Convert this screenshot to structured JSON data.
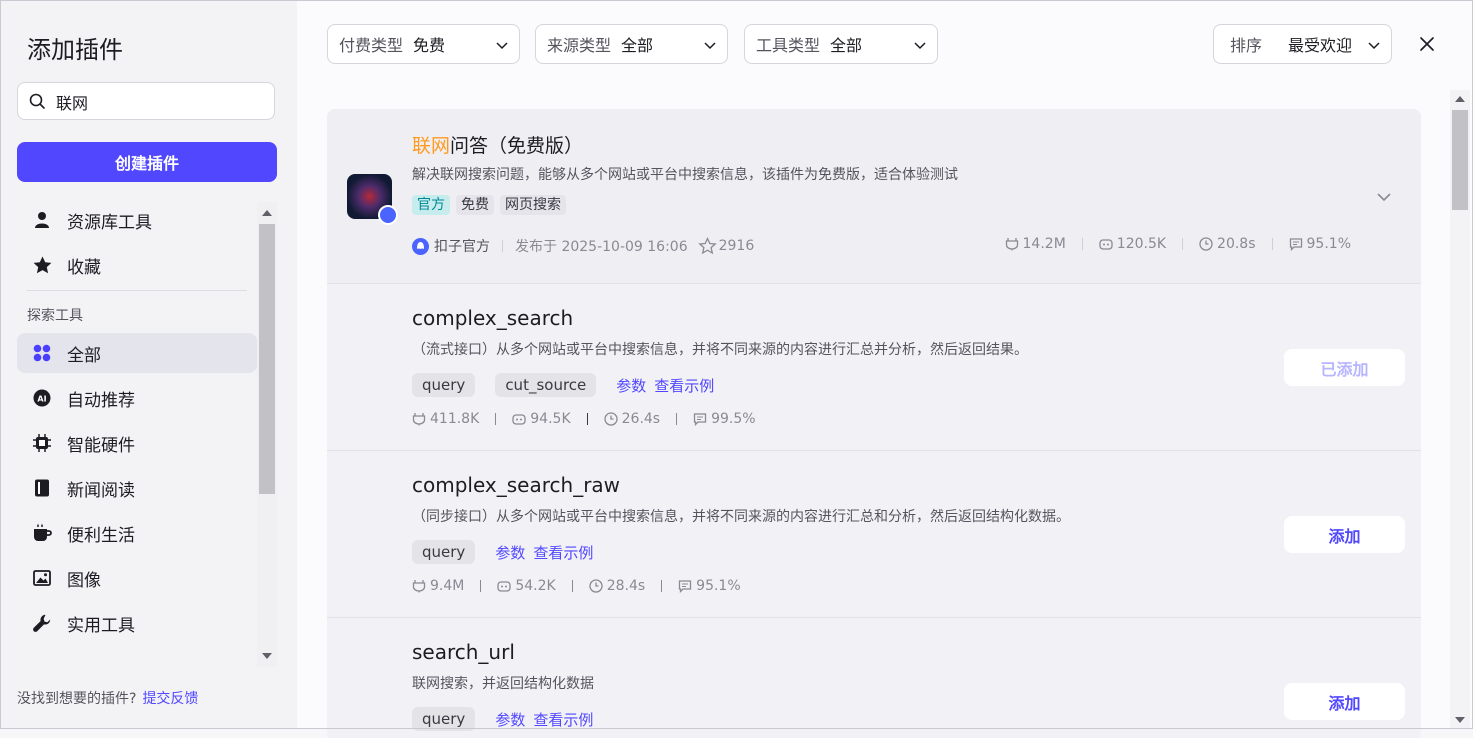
{
  "sidebar": {
    "title": "添加插件",
    "search_value": "联网",
    "create_label": "创建插件",
    "items_top": [
      {
        "label": "资源库工具",
        "icon": "person-icon"
      },
      {
        "label": "收藏",
        "icon": "star-icon"
      }
    ],
    "section_label": "探索工具",
    "items": [
      {
        "label": "全部",
        "icon": "grid-icon",
        "active": true
      },
      {
        "label": "自动推荐",
        "icon": "ai-icon"
      },
      {
        "label": "智能硬件",
        "icon": "chip-icon"
      },
      {
        "label": "新闻阅读",
        "icon": "book-icon"
      },
      {
        "label": "便利生活",
        "icon": "cup-icon"
      },
      {
        "label": "图像",
        "icon": "image-icon"
      },
      {
        "label": "实用工具",
        "icon": "wrench-icon"
      }
    ],
    "footer_text": "没找到想要的插件?",
    "footer_link": "提交反馈"
  },
  "filters": {
    "pay": {
      "label": "付费类型",
      "value": "免费"
    },
    "source": {
      "label": "来源类型",
      "value": "全部"
    },
    "tool": {
      "label": "工具类型",
      "value": "全部"
    },
    "sort": {
      "label": "排序",
      "value": "最受欢迎"
    }
  },
  "plugin": {
    "title_highlight": "联网",
    "title_rest": "问答（免费版）",
    "description": "解决联网搜索问题，能够从多个网站或平台中搜索信息，该插件为免费版，适合体验测试",
    "tags": [
      "官方",
      "免费",
      "网页搜索"
    ],
    "author": "扣子官方",
    "published": "发布于 2025-10-09 16:06",
    "favorites": "2916",
    "stats": {
      "calls": "14.2M",
      "bots": "120.5K",
      "latency": "20.8s",
      "success": "95.1%"
    }
  },
  "tools": [
    {
      "name": "complex_search",
      "description": "（流式接口）从多个网站或平台中搜索信息，并将不同来源的内容进行汇总并分析，然后返回结果。",
      "params": [
        "query",
        "cut_source"
      ],
      "params_link": "参数",
      "example_link": "查看示例",
      "stats": {
        "calls": "411.8K",
        "bots": "94.5K",
        "latency": "26.4s",
        "success": "99.5%"
      },
      "button": "已添加",
      "added": true
    },
    {
      "name": "complex_search_raw",
      "description": "（同步接口）从多个网站或平台中搜索信息，并将不同来源的内容进行汇总和分析，然后返回结构化数据。",
      "params": [
        "query"
      ],
      "params_link": "参数",
      "example_link": "查看示例",
      "stats": {
        "calls": "9.4M",
        "bots": "54.2K",
        "latency": "28.4s",
        "success": "95.1%"
      },
      "button": "添加",
      "added": false
    },
    {
      "name": "search_url",
      "description": "联网搜索，并返回结构化数据",
      "params": [
        "query"
      ],
      "params_link": "参数",
      "example_link": "查看示例",
      "button": "添加",
      "added": false
    }
  ],
  "colors": {
    "accent": "#5147ff",
    "highlight": "#ff9a1f",
    "official_tag": "#008a96"
  }
}
